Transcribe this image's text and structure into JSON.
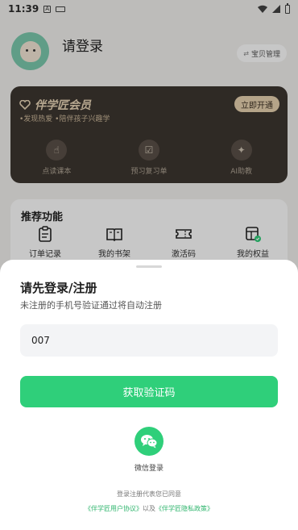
{
  "status_bar": {
    "time": "11:39",
    "a_icon": "A"
  },
  "profile": {
    "login_title": "请登录",
    "baby_manage": "宝贝管理"
  },
  "vip": {
    "title": "伴学匠会员",
    "subtitle": "•发现热爱  •陪伴孩子兴趣学",
    "open_button": "立即开通",
    "features": [
      {
        "label": "点读课本",
        "icon": "hand-point-icon"
      },
      {
        "label": "预习复习单",
        "icon": "checklist-icon"
      },
      {
        "label": "AI助教",
        "icon": "sparkle-icon"
      }
    ]
  },
  "recommend": {
    "title": "推荐功能",
    "items": [
      {
        "label": "订单记录",
        "icon": "clipboard-icon"
      },
      {
        "label": "我的书架",
        "icon": "book-icon"
      },
      {
        "label": "激活码",
        "icon": "ticket-icon"
      },
      {
        "label": "我的权益",
        "icon": "benefits-icon"
      }
    ]
  },
  "login_sheet": {
    "title": "请先登录/注册",
    "subtitle": "未注册的手机号验证通过将自动注册",
    "phone_value": "007",
    "get_code_button": "获取验证码",
    "wechat_label": "微信登录",
    "agreement_prefix": "登录注册代表您已同意",
    "user_agreement": "《伴学匠用户协议》",
    "and": "以及",
    "privacy_policy": "《伴学匠隐私政策》"
  },
  "colors": {
    "accent_green": "#2fcf7a",
    "vip_card": "#3d3630",
    "vip_gold": "#e8d3b0"
  }
}
